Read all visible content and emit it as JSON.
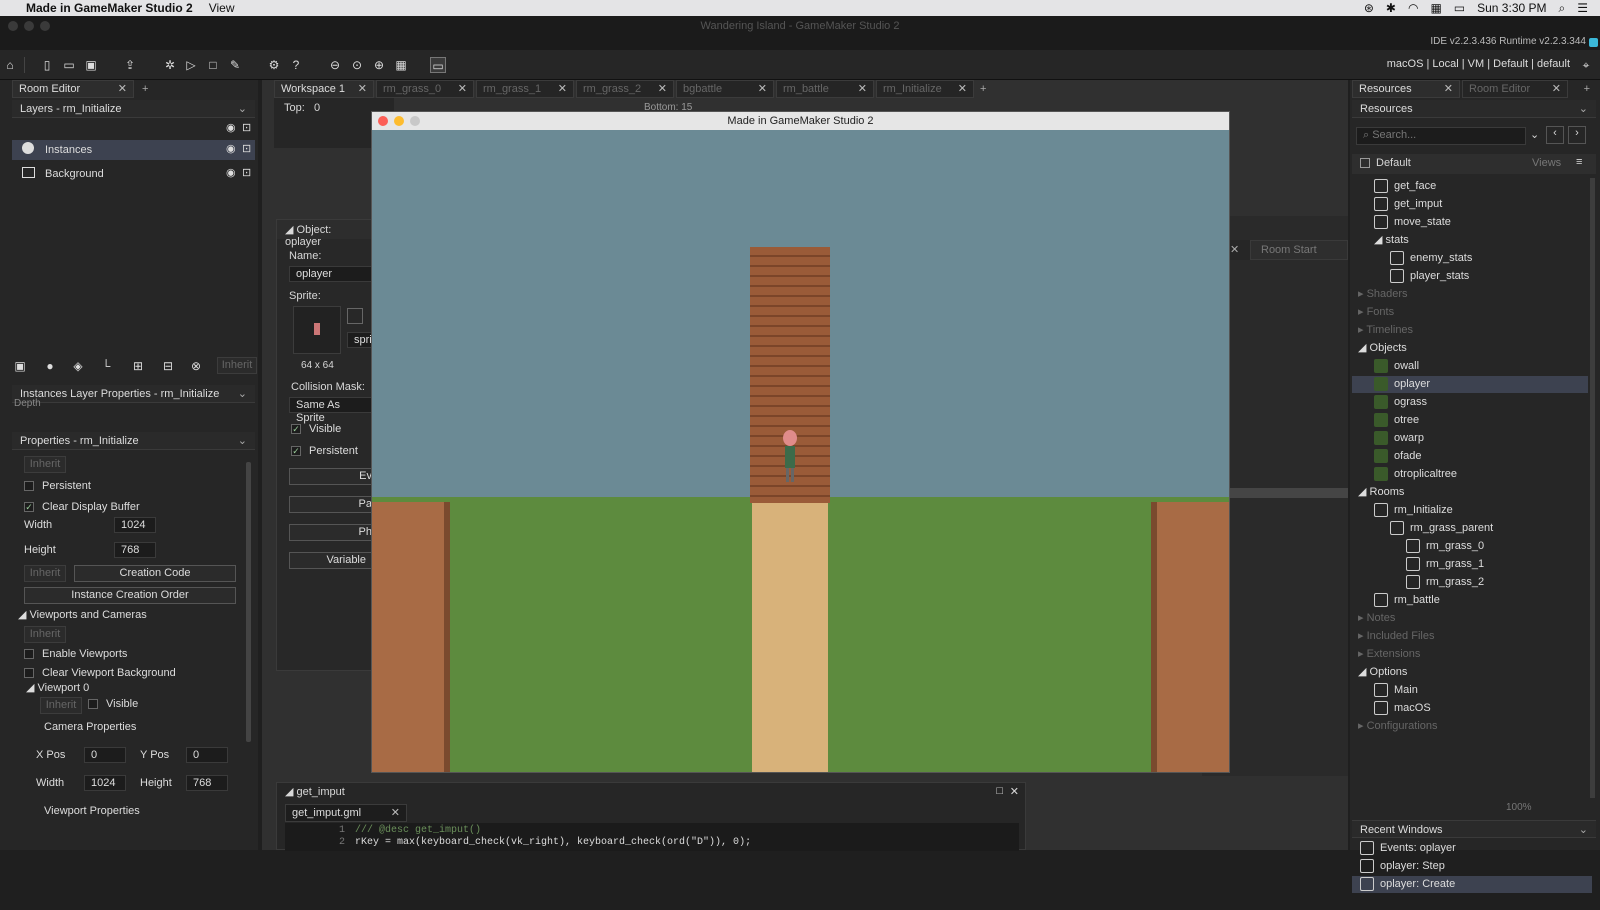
{
  "mac_menubar": {
    "app_name": "Made in GameMaker Studio 2",
    "menu_view": "View",
    "clock": "Sun 3:30 PM"
  },
  "window_title": "Wandering Island - GameMaker Studio 2",
  "version_info": "IDE v2.2.3.436  Runtime v2.2.3.344",
  "target_bar": "macOS  |  Local  |  VM  |  Default  |  default",
  "room_editor": {
    "tab": "Room Editor",
    "layers_header": "Layers - rm_Initialize",
    "layers": [
      {
        "name": "Instances"
      },
      {
        "name": "Background"
      }
    ],
    "inherit": "Inherit",
    "instances_layer_props": "Instances Layer Properties - rm_Initialize",
    "depth_label": "Depth",
    "properties_header": "Properties - rm_Initialize",
    "persistent": "Persistent",
    "clear_display": "Clear Display Buffer",
    "width_label": "Width",
    "width": "1024",
    "height_label": "Height",
    "height": "768",
    "creation_code": "Creation Code",
    "instance_order": "Instance Creation Order",
    "viewports": "Viewports and Cameras",
    "enable_viewports": "Enable Viewports",
    "clear_viewport": "Clear Viewport Background",
    "viewport0": "Viewport 0",
    "visible": "Visible",
    "camera_props": "Camera Properties",
    "xpos_label": "X Pos",
    "xpos": "0",
    "ypos_label": "Y Pos",
    "ypos": "0",
    "cam_width": "1024",
    "cam_height": "768",
    "viewport_props": "Viewport Properties"
  },
  "workspace_tabs": [
    "Workspace 1",
    "rm_grass_0",
    "rm_grass_1",
    "rm_grass_2",
    "bgbattle",
    "rm_battle",
    "rm_Initialize"
  ],
  "workspace": {
    "top_label": "Top:",
    "top_value": "0",
    "bottom_label": "Bottom:",
    "bottom_value": "15",
    "object_panel": {
      "title": "Object: oplayer",
      "name_label": "Name:",
      "name": "oplayer",
      "sprite_label": "Sprite:",
      "sprite_size": "64 x 64",
      "sprite_field": "spri",
      "collision_label": "Collision Mask:",
      "collision": "Same As Sprite",
      "visible": "Visible",
      "persistent": "Persistent",
      "buttons": [
        "Ev",
        "Pa",
        "Ph",
        "Variable"
      ]
    },
    "room_start": "Room Start",
    "code_panel": {
      "title": "get_imput",
      "tab": "get_imput.gml",
      "lines": [
        {
          "n": "1",
          "text": "/// @desc get_imput()"
        },
        {
          "n": "2",
          "text": "rKey = max(keyboard_check(vk_right), keyboard_check(ord(\"D\")), 0);"
        }
      ]
    }
  },
  "game_window": {
    "title": "Made in GameMaker Studio 2"
  },
  "resources": {
    "tabs": [
      "Resources",
      "Room Editor"
    ],
    "header": "Resources",
    "search_placeholder": "Search...",
    "group": "Default",
    "views": "Views",
    "items": [
      {
        "label": "get_face",
        "indent": 1,
        "kind": "script"
      },
      {
        "label": "get_imput",
        "indent": 1,
        "kind": "script"
      },
      {
        "label": "move_state",
        "indent": 1,
        "kind": "script"
      },
      {
        "label": "stats",
        "indent": 1,
        "kind": "folder"
      },
      {
        "label": "enemy_stats",
        "indent": 2,
        "kind": "script"
      },
      {
        "label": "player_stats",
        "indent": 2,
        "kind": "script"
      },
      {
        "label": "Shaders",
        "indent": 0,
        "kind": "section"
      },
      {
        "label": "Fonts",
        "indent": 0,
        "kind": "section"
      },
      {
        "label": "Timelines",
        "indent": 0,
        "kind": "section"
      },
      {
        "label": "Objects",
        "indent": 0,
        "kind": "open"
      },
      {
        "label": "owall",
        "indent": 1,
        "kind": "obj"
      },
      {
        "label": "oplayer",
        "indent": 1,
        "kind": "obj",
        "selected": true
      },
      {
        "label": "ograss",
        "indent": 1,
        "kind": "obj"
      },
      {
        "label": "otree",
        "indent": 1,
        "kind": "obj"
      },
      {
        "label": "owarp",
        "indent": 1,
        "kind": "obj"
      },
      {
        "label": "ofade",
        "indent": 1,
        "kind": "obj"
      },
      {
        "label": "otroplicaltree",
        "indent": 1,
        "kind": "obj"
      },
      {
        "label": "Rooms",
        "indent": 0,
        "kind": "open"
      },
      {
        "label": "rm_Initialize",
        "indent": 1,
        "kind": "room"
      },
      {
        "label": "rm_grass_parent",
        "indent": 2,
        "kind": "room"
      },
      {
        "label": "rm_grass_0",
        "indent": 3,
        "kind": "room"
      },
      {
        "label": "rm_grass_1",
        "indent": 3,
        "kind": "room"
      },
      {
        "label": "rm_grass_2",
        "indent": 3,
        "kind": "room"
      },
      {
        "label": "rm_battle",
        "indent": 1,
        "kind": "room"
      },
      {
        "label": "Notes",
        "indent": 0,
        "kind": "section"
      },
      {
        "label": "Included Files",
        "indent": 0,
        "kind": "section"
      },
      {
        "label": "Extensions",
        "indent": 0,
        "kind": "section"
      },
      {
        "label": "Options",
        "indent": 0,
        "kind": "open"
      },
      {
        "label": "Main",
        "indent": 1,
        "kind": "opt"
      },
      {
        "label": "macOS",
        "indent": 1,
        "kind": "opt"
      },
      {
        "label": "Configurations",
        "indent": 0,
        "kind": "section"
      }
    ],
    "zoom": "100%",
    "recent_header": "Recent Windows",
    "recent": [
      {
        "label": "Events: oplayer"
      },
      {
        "label": "oplayer: Step"
      },
      {
        "label": "oplayer: Create",
        "selected": true
      }
    ]
  }
}
